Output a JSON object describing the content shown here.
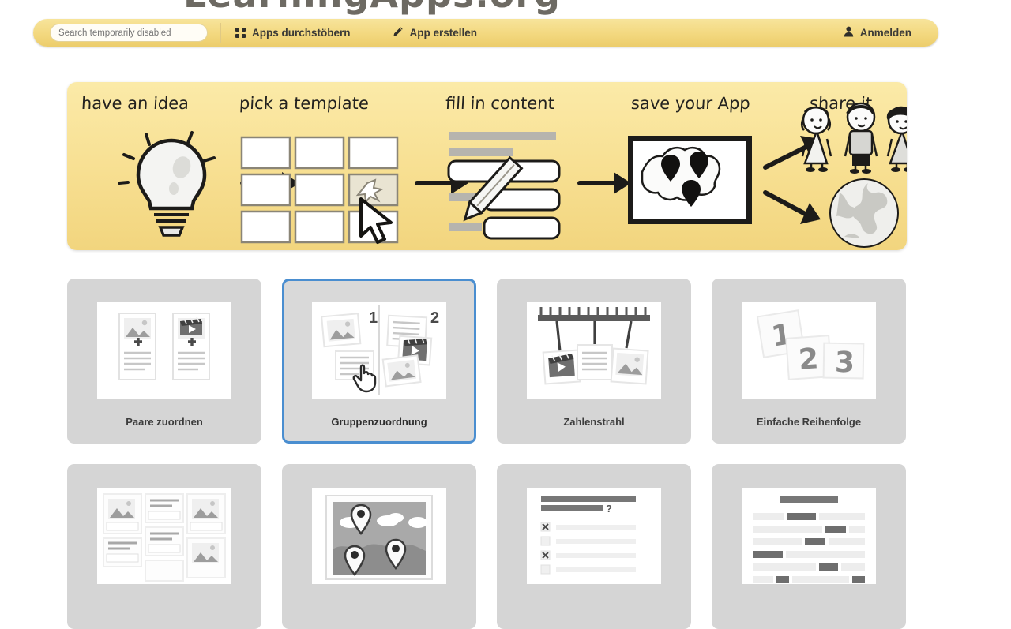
{
  "brand": {
    "name": "LearningApps.org",
    "logo_icon": "pencil-brush-ruler-icon"
  },
  "toolbar": {
    "search": {
      "value": "",
      "placeholder": "Search temporarily disabled",
      "icon": "search-icon"
    },
    "browse_apps": {
      "label": "Apps durchstöbern",
      "icon": "grid-icon"
    },
    "create_app": {
      "label": "App erstellen",
      "icon": "pencil-icon"
    },
    "login": {
      "label": "Anmelden",
      "icon": "user-icon"
    }
  },
  "banner": {
    "steps": [
      {
        "title": "have an idea",
        "icon": "lightbulb-icon"
      },
      {
        "title": "pick a template",
        "icon": "grid-cursor-icon"
      },
      {
        "title": "fill in content",
        "icon": "form-pencil-icon"
      },
      {
        "title": "save your App",
        "icon": "map-pins-icon"
      },
      {
        "title": "share it",
        "icon": "people-globe-icon"
      }
    ]
  },
  "templates": {
    "selected_index": 1,
    "items": [
      {
        "label": "Paare zuordnen",
        "thumb": "pair-matching-thumb",
        "selected": false
      },
      {
        "label": "Gruppenzuordnung",
        "thumb": "group-assignment-thumb",
        "selected": true,
        "group_numbers": [
          "1",
          "2"
        ]
      },
      {
        "label": "Zahlenstrahl",
        "thumb": "number-line-thumb",
        "selected": false
      },
      {
        "label": "Einfache Reihenfolge",
        "thumb": "simple-order-thumb",
        "selected": false,
        "card_numbers": [
          "1",
          "2",
          "3"
        ]
      },
      {
        "label": "",
        "thumb": "grid-matching-thumb",
        "selected": false
      },
      {
        "label": "",
        "thumb": "map-quiz-thumb",
        "selected": false
      },
      {
        "label": "",
        "thumb": "multiple-choice-thumb",
        "selected": false
      },
      {
        "label": "",
        "thumb": "cloze-text-thumb",
        "selected": false
      }
    ]
  },
  "colors": {
    "toolbar_yellow": "#f3d87f",
    "banner_yellow": "#f8e195",
    "card_gray": "#d5d5d5",
    "selected_blue": "#4a8ed0",
    "text_dark": "#3d3d3d"
  }
}
